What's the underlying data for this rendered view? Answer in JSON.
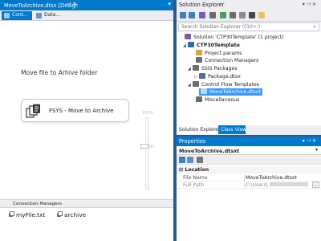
{
  "document": {
    "tab_title": "MoveToArchive.dtsx [Design]",
    "design_tabs": [
      "Cont...",
      "Data..."
    ]
  },
  "canvas": {
    "message": "Move file to Arhive folder",
    "task_label": "FSYS - Move to Archive",
    "zoom_label": "100%"
  },
  "connection_managers": {
    "header": "Connection Managers",
    "items": [
      {
        "label": "myFile.txt",
        "icon": "file-connection-icon"
      },
      {
        "label": "archive",
        "icon": "folder-connection-icon"
      }
    ]
  },
  "solution_explorer": {
    "title": "Solution Explorer",
    "search_placeholder": "Search Solution Explorer (Ctrl+;)",
    "tree": [
      {
        "label": "Solution 'CTP30Template' (1 project)",
        "level": 0,
        "icon": "solution-icon",
        "arrow": ""
      },
      {
        "label": "CTP30Template",
        "level": 1,
        "icon": "project-icon",
        "arrow": "◢",
        "bold": true
      },
      {
        "label": "Project.params",
        "level": 2,
        "icon": "params-icon",
        "arrow": ""
      },
      {
        "label": "Connection Managers",
        "level": 2,
        "icon": "folder-icon",
        "arrow": ""
      },
      {
        "label": "SSIS Packages",
        "level": 2,
        "icon": "folder-icon",
        "arrow": "◢"
      },
      {
        "label": "Package.dtsx",
        "level": 3,
        "icon": "package-icon",
        "arrow": "▷"
      },
      {
        "label": "Control Flow Templates",
        "level": 2,
        "icon": "folder-icon",
        "arrow": "◢"
      },
      {
        "label": "MoveToArchive.dtsxt",
        "level": 3,
        "icon": "package-icon",
        "arrow": "",
        "selected": true
      },
      {
        "label": "Miscellaneous",
        "level": 2,
        "icon": "folder-icon",
        "arrow": ""
      }
    ],
    "tabs": [
      "Solution Explorer",
      "Class View"
    ]
  },
  "properties": {
    "title": "Properties",
    "object": "MoveToArchive.dtsxt",
    "category": "Location",
    "rows": [
      {
        "name": "File Name",
        "value": "MoveToArchive.dtsxt"
      },
      {
        "name": "Full Path",
        "value": "C:\\Users\\"
      }
    ]
  },
  "colors": {
    "accent": "#007acc",
    "frame": "#2b579a",
    "selection": "#3399ff"
  }
}
